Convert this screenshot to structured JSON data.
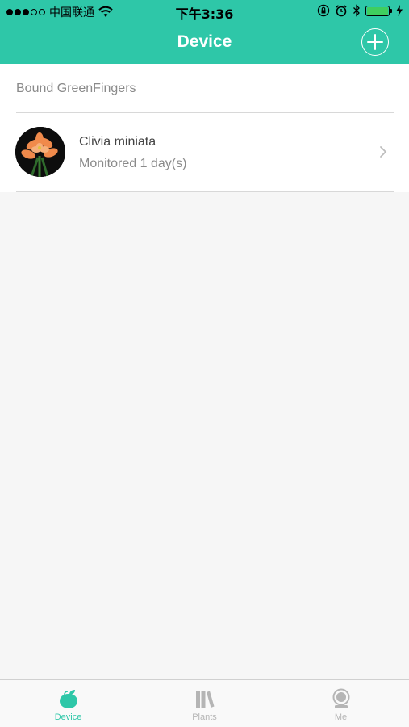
{
  "status_bar": {
    "carrier": "中国联通",
    "time": "下午3:36",
    "battery_level": 1.0
  },
  "nav": {
    "title": "Device",
    "add_icon": "plus-circle-icon"
  },
  "section": {
    "header": "Bound GreenFingers"
  },
  "devices": [
    {
      "name": "Clivia miniata",
      "status": "Monitored 1 day(s)"
    }
  ],
  "tabs": [
    {
      "label": "Device",
      "icon": "device-icon",
      "active": true
    },
    {
      "label": "Plants",
      "icon": "plants-icon",
      "active": false
    },
    {
      "label": "Me",
      "icon": "me-icon",
      "active": false
    }
  ],
  "colors": {
    "accent": "#2ec7a8",
    "background": "#f6f6f6",
    "inactive": "#b5b5b5"
  }
}
